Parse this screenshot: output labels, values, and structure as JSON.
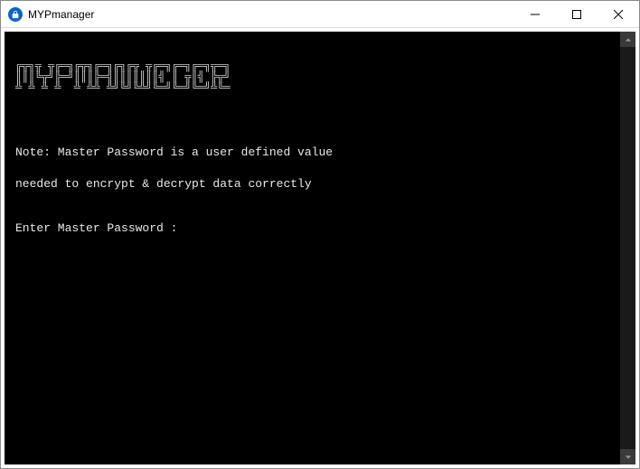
{
  "window": {
    "title": "MYPmanager"
  },
  "console": {
    "ascii_logo": "╔╦╗╦ ╦╔═╗╔╦╗╔═╗╔╗╔╦ ╦╔═╗╔═╗╔═╗╦═╗\n║║║╚╦╝╠═╝║║║╠═╣║║║║║║║╣ ║ ╦║╣ ╠╦╝\n╩ ╩ ╩ ╩  ╩ ╩╩ ╩╝╚╝╚╩╝╚═╝╚═╝╚═╝╩╚═",
    "note_line_1": "Note: Master Password is a user defined value",
    "note_line_2": "needed to encrypt & decrypt data correctly",
    "prompt": "Enter Master Password : "
  }
}
